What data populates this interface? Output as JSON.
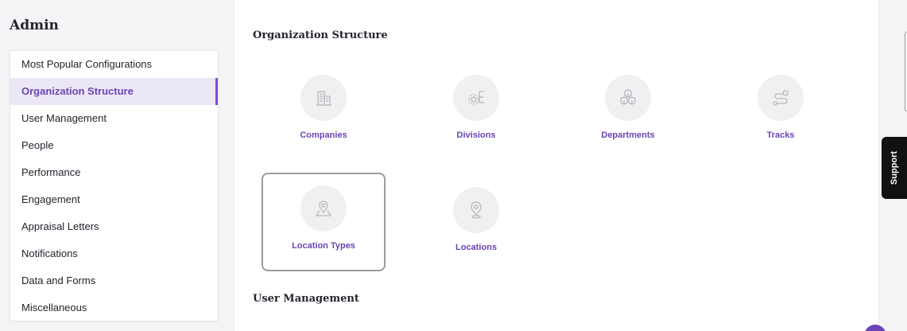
{
  "sidebar": {
    "title": "Admin",
    "items": [
      {
        "label": "Most Popular Configurations",
        "active": false
      },
      {
        "label": "Organization Structure",
        "active": true
      },
      {
        "label": "User Management",
        "active": false
      },
      {
        "label": "People",
        "active": false
      },
      {
        "label": "Performance",
        "active": false
      },
      {
        "label": "Engagement",
        "active": false
      },
      {
        "label": "Appraisal Letters",
        "active": false
      },
      {
        "label": "Notifications",
        "active": false
      },
      {
        "label": "Data and Forms",
        "active": false
      },
      {
        "label": "Miscellaneous",
        "active": false
      }
    ]
  },
  "main": {
    "sections": [
      {
        "title": "Organization Structure",
        "tiles": [
          {
            "label": "Companies",
            "icon": "building-icon"
          },
          {
            "label": "Divisions",
            "icon": "gear-list-icon"
          },
          {
            "label": "Departments",
            "icon": "cubes-icon"
          },
          {
            "label": "Tracks",
            "icon": "route-icon"
          },
          {
            "label": "Location Types",
            "icon": "map-pin-area-icon"
          },
          {
            "label": "Locations",
            "icon": "map-pin-icon"
          }
        ]
      },
      {
        "title": "User Management"
      }
    ]
  },
  "support": {
    "label": "Support"
  },
  "colors": {
    "accent": "#6a45b5",
    "active_bg": "#ece7f6",
    "icon_circle": "#f0f0f2",
    "icon_stroke": "#b9b9bd",
    "support_bg": "#111111"
  }
}
